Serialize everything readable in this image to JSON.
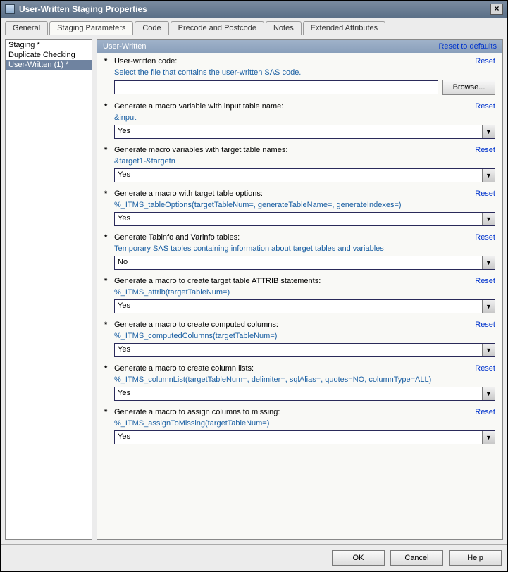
{
  "title": "User-Written Staging Properties",
  "tabs": {
    "general": "General",
    "staging_parameters": "Staging Parameters",
    "code": "Code",
    "precode_postcode": "Precode and Postcode",
    "notes": "Notes",
    "extended_attributes": "Extended Attributes"
  },
  "sidebar": {
    "items": [
      {
        "label": "Staging *"
      },
      {
        "label": "Duplicate Checking"
      },
      {
        "label": "User-Written (1) *"
      }
    ]
  },
  "main_header": {
    "title": "User-Written",
    "reset_defaults": "Reset to defaults"
  },
  "common": {
    "reset": "Reset",
    "browse": "Browse..."
  },
  "properties": [
    {
      "label": "User-written code:",
      "sublabel": "Select the file that contains the user-written SAS code.",
      "control": "textbrowse",
      "value": ""
    },
    {
      "label": "Generate a macro variable with input table name:",
      "sublabel": "&input",
      "control": "dropdown",
      "value": "Yes"
    },
    {
      "label": "Generate macro variables with target table names:",
      "sublabel": "&target1-&targetn",
      "control": "dropdown",
      "value": "Yes"
    },
    {
      "label": "Generate a macro with target table options:",
      "sublabel": "%_ITMS_tableOptions(targetTableNum=, generateTableName=, generateIndexes=)",
      "control": "dropdown",
      "value": "Yes"
    },
    {
      "label": "Generate Tabinfo and Varinfo tables:",
      "sublabel": "Temporary SAS tables containing information about target tables and variables",
      "control": "dropdown",
      "value": "No"
    },
    {
      "label": "Generate a macro to create target table ATTRIB statements:",
      "sublabel": "%_ITMS_attrib(targetTableNum=)",
      "control": "dropdown",
      "value": "Yes"
    },
    {
      "label": "Generate a macro to create computed columns:",
      "sublabel": "%_ITMS_computedColumns(targetTableNum=)",
      "control": "dropdown",
      "value": "Yes"
    },
    {
      "label": "Generate a macro to create column lists:",
      "sublabel": "%_ITMS_columnList(targetTableNum=, delimiter=, sqlAlias=, quotes=NO, columnType=ALL)",
      "control": "dropdown",
      "value": "Yes"
    },
    {
      "label": "Generate a macro to assign columns to missing:",
      "sublabel": "%_ITMS_assignToMissing(targetTableNum=)",
      "control": "dropdown",
      "value": "Yes"
    }
  ],
  "footer": {
    "ok": "OK",
    "cancel": "Cancel",
    "help": "Help"
  }
}
